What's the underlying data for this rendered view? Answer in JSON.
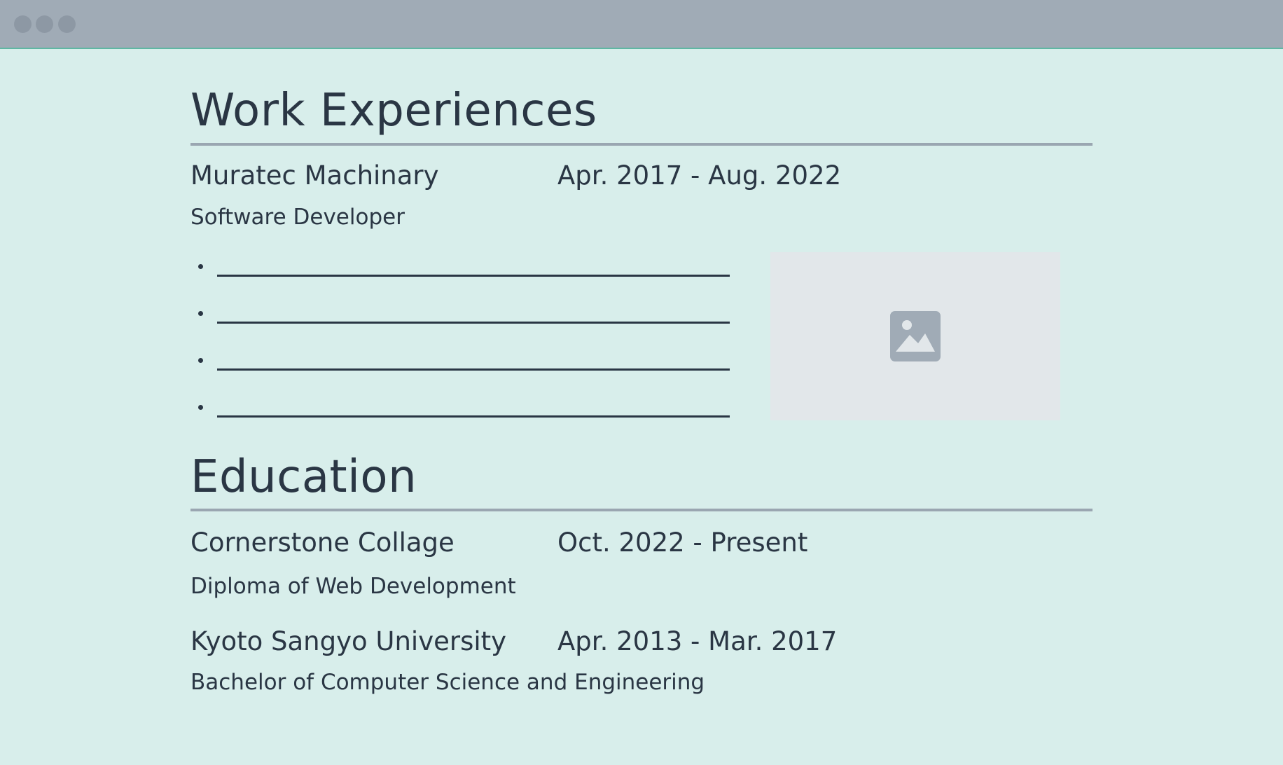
{
  "work": {
    "title": "Work Experiences",
    "entries": [
      {
        "organization": "Muratec Machinary",
        "dates": "Apr. 2017 - Aug. 2022",
        "role": "Software Developer",
        "bullet_count": 4
      }
    ],
    "image_icon": "image-placeholder-icon"
  },
  "education": {
    "title": "Education",
    "entries": [
      {
        "organization": "Cornerstone Collage",
        "dates": "Oct. 2022 - Present",
        "credential": "Diploma of Web Development"
      },
      {
        "organization": "Kyoto Sangyo University",
        "dates": "Apr. 2013 - Mar. 2017",
        "credential": "Bachelor of Computer Science and Engineering"
      }
    ]
  },
  "colors": {
    "background": "#d8eeeb",
    "titlebar": "#a0abb6",
    "text": "#2a3644",
    "rule": "#9aa6b1",
    "placeholder": "#e2e7ea"
  }
}
